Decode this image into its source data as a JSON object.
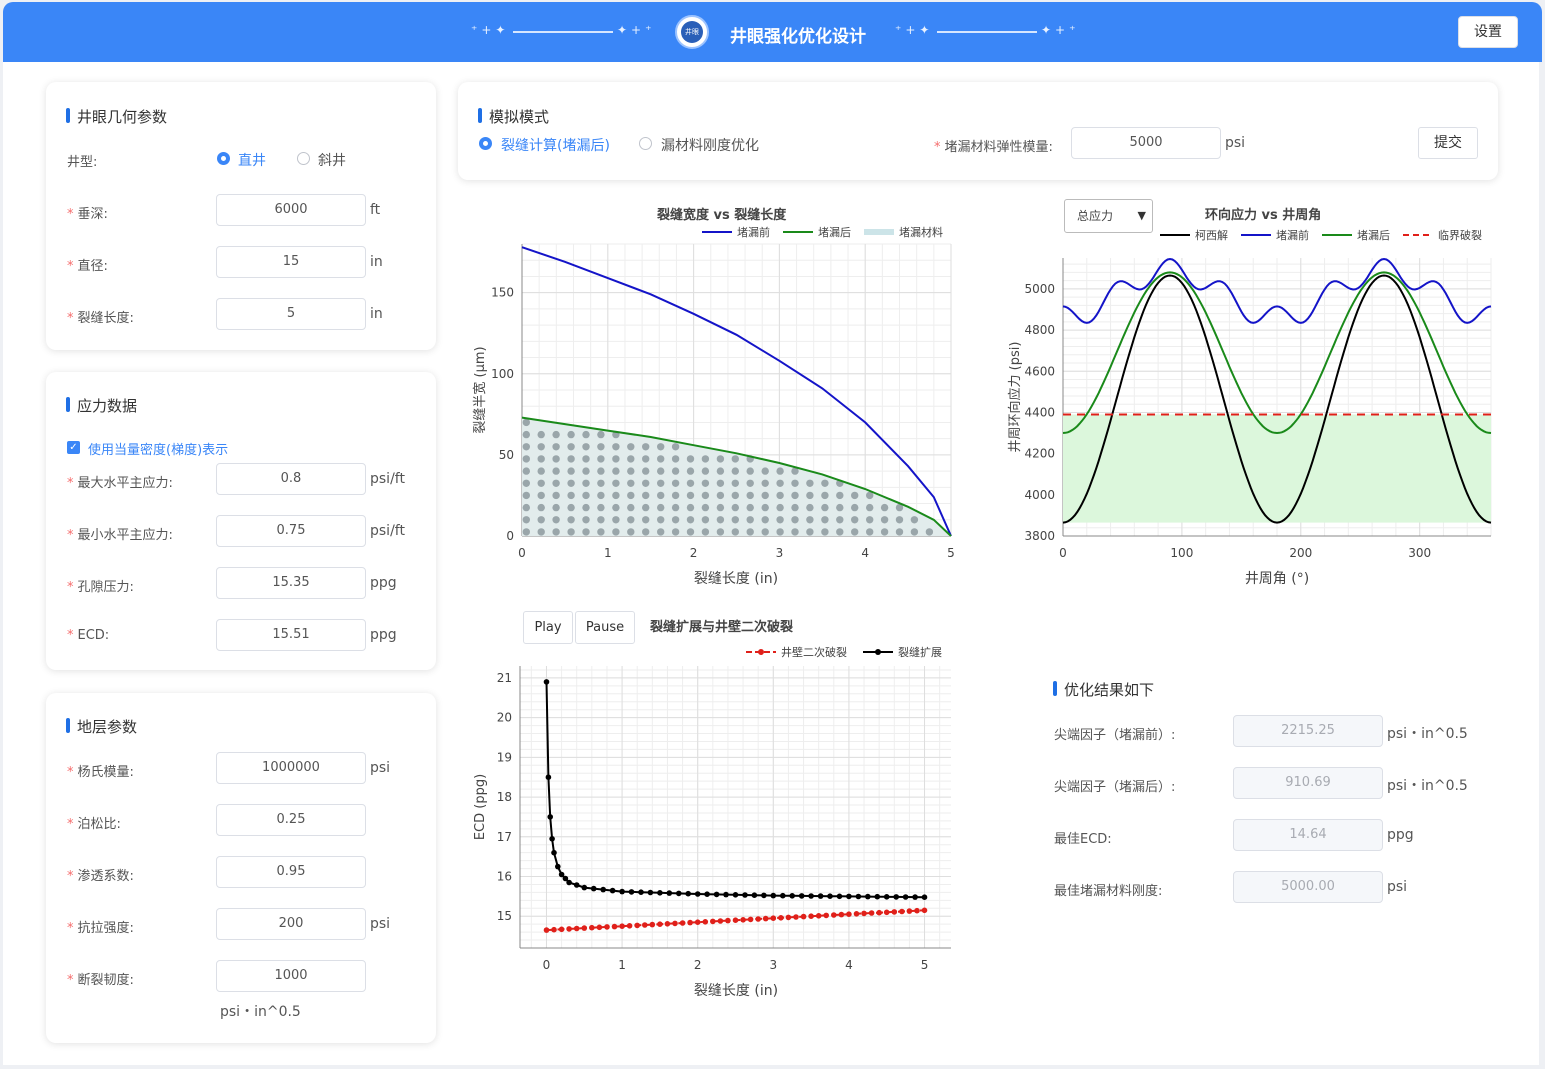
{
  "header": {
    "title": "井眼强化优化设计",
    "logo_text": "井眼",
    "settings_label": "设置"
  },
  "geometry": {
    "title": "井眼几何参数",
    "well_type_label": "井型:",
    "well_types": [
      "直井",
      "斜井"
    ],
    "selected_well_type": "直井",
    "depth": {
      "label": "垂深:",
      "value": "6000",
      "unit": "ft"
    },
    "diameter": {
      "label": "直径:",
      "value": "15",
      "unit": "in"
    },
    "crack_length": {
      "label": "裂缝长度:",
      "value": "5",
      "unit": "in"
    }
  },
  "stress": {
    "title": "应力数据",
    "checkbox_label": "使用当量密度(梯度)表示",
    "checked": true,
    "fields": [
      {
        "label": "最大水平主应力:",
        "value": "0.8",
        "unit": "psi/ft"
      },
      {
        "label": "最小水平主应力:",
        "value": "0.75",
        "unit": "psi/ft"
      },
      {
        "label": "孔隙压力:",
        "value": "15.35",
        "unit": "ppg"
      },
      {
        "label": "ECD:",
        "value": "15.51",
        "unit": "ppg"
      }
    ]
  },
  "formation": {
    "title": "地层参数",
    "fields": [
      {
        "label": "杨氏模量:",
        "value": "1000000",
        "unit": "psi"
      },
      {
        "label": "泊松比:",
        "value": "0.25",
        "unit": ""
      },
      {
        "label": "渗透系数:",
        "value": "0.95",
        "unit": ""
      },
      {
        "label": "抗拉强度:",
        "value": "200",
        "unit": "psi"
      },
      {
        "label": "断裂韧度:",
        "value": "1000",
        "unit": ""
      }
    ],
    "toughness_unit": "psi・in^0.5"
  },
  "mode": {
    "title": "模拟模式",
    "options": [
      "裂缝计算(堵漏后)",
      "漏材料刚度优化"
    ],
    "selected": "裂缝计算(堵漏后)",
    "modulus_label": "堵漏材料弹性模量:",
    "modulus_value": "5000",
    "modulus_unit": "psi",
    "submit_label": "提交"
  },
  "results": {
    "title": "优化结果如下",
    "fields": [
      {
        "label": "尖端因子（堵漏前）:",
        "value": "2215.25",
        "unit": "psi・in^0.5"
      },
      {
        "label": "尖端因子（堵漏后）:",
        "value": "910.69",
        "unit": "psi・in^0.5"
      },
      {
        "label": "最佳ECD:",
        "value": "14.64",
        "unit": "ppg"
      },
      {
        "label": "最佳堵漏材料刚度:",
        "value": "5000.00",
        "unit": "psi"
      }
    ]
  },
  "controls": {
    "play_label": "Play",
    "pause_label": "Pause",
    "stress_select_value": "总应力"
  },
  "colors": {
    "accent": "#3a86f7",
    "before": "#1414c8",
    "after": "#1a8a1a",
    "material": "#9aa6aa",
    "kirsch": "#000000",
    "critical": "#e0201a"
  },
  "chart_data": [
    {
      "type": "area",
      "title": "裂缝宽度 vs 裂缝长度",
      "xlabel": "裂缝长度 (in)",
      "ylabel": "裂缝半宽 (μm)",
      "xlim": [
        0,
        5
      ],
      "ylim": [
        0,
        180
      ],
      "xticks": [
        0,
        1,
        2,
        3,
        4,
        5
      ],
      "yticks": [
        0,
        50,
        100,
        150
      ],
      "legend": "top-right",
      "legend_labels": [
        "堵漏前",
        "堵漏后",
        "堵漏材料"
      ],
      "series": [
        {
          "name": "堵漏前",
          "x": [
            0,
            0.5,
            1,
            1.5,
            2,
            2.5,
            3,
            3.5,
            4,
            4.5,
            4.8,
            5
          ],
          "values": [
            178,
            169,
            159,
            149,
            137,
            124,
            108,
            91,
            70,
            43,
            24,
            0
          ]
        },
        {
          "name": "堵漏后",
          "x": [
            0,
            0.5,
            1,
            1.5,
            2,
            2.5,
            3,
            3.5,
            4,
            4.5,
            4.8,
            5
          ],
          "values": [
            73,
            69,
            65,
            61,
            56,
            51,
            45,
            38,
            29,
            18,
            10,
            0
          ]
        }
      ]
    },
    {
      "type": "line",
      "title": "环向应力 vs 井周角",
      "xlabel": "井周角 (°)",
      "ylabel": "井周环向应力 (psi)",
      "xlim": [
        0,
        360
      ],
      "ylim": [
        3800,
        5150
      ],
      "xticks": [
        0,
        100,
        200,
        300
      ],
      "yticks": [
        3800,
        4000,
        4200,
        4400,
        4600,
        4800,
        5000
      ],
      "legend": "top-right",
      "legend_labels": [
        "柯西解",
        "堵漏前",
        "堵漏后",
        "临界破裂"
      ],
      "critical": 4390,
      "kirsch": {
        "min": 3865,
        "max": 5065
      },
      "after": {
        "min": 4300,
        "max": 5080
      },
      "before": {
        "base": 4975,
        "amp": 115,
        "ripple": 110
      }
    },
    {
      "type": "line",
      "title": "裂缝扩展与井壁二次破裂",
      "xlabel": "裂缝长度 (in)",
      "ylabel": "ECD (ppg)",
      "xlim": [
        -0.35,
        5.35
      ],
      "ylim": [
        14.2,
        21.3
      ],
      "xticks": [
        0,
        1,
        2,
        3,
        4,
        5
      ],
      "yticks": [
        15,
        16,
        17,
        18,
        19,
        20,
        21
      ],
      "legend": "top-right",
      "legend_labels": [
        "井壁二次破裂",
        "裂缝扩展"
      ],
      "series": [
        {
          "name": "裂缝扩展",
          "x": [
            0,
            0.025,
            0.05,
            0.075,
            0.1,
            0.15,
            0.2,
            0.3,
            0.5,
            1,
            2,
            3,
            4,
            5
          ],
          "values": [
            20.9,
            18.5,
            17.5,
            16.95,
            16.6,
            16.25,
            16.05,
            15.85,
            15.72,
            15.62,
            15.56,
            15.52,
            15.5,
            15.48
          ]
        },
        {
          "name": "井壁二次破裂",
          "x": [
            0,
            5
          ],
          "values": [
            14.65,
            15.15
          ]
        }
      ]
    }
  ]
}
